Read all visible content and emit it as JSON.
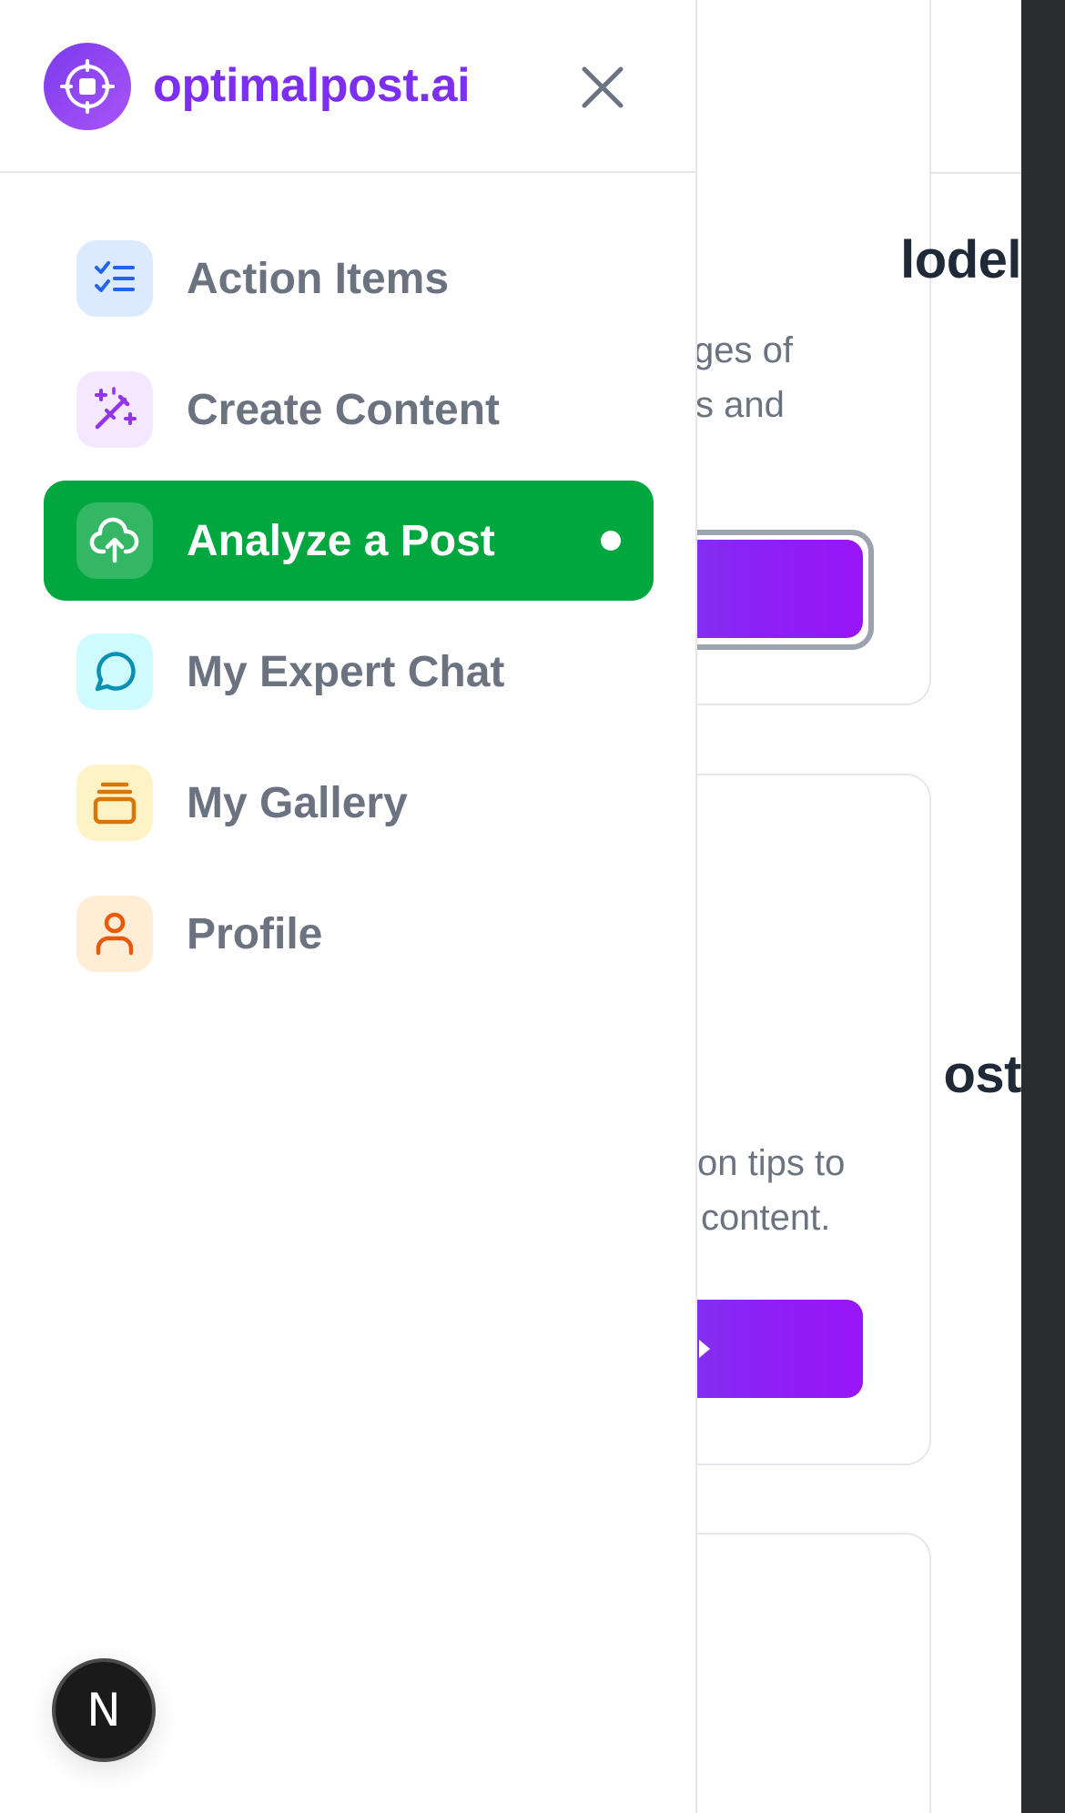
{
  "app": {
    "brand": "optimalpost.ai"
  },
  "nav": {
    "items": [
      {
        "label": "Action Items",
        "icon": "list-checks-icon",
        "icon_color": "#2563eb",
        "icon_bg": "#dbeafe",
        "active": false
      },
      {
        "label": "Create Content",
        "icon": "magic-wand-icon",
        "icon_color": "#9333ea",
        "icon_bg": "#f3e8ff",
        "active": false
      },
      {
        "label": "Analyze a Post",
        "icon": "cloud-upload-icon",
        "icon_color": "#ffffff",
        "icon_bg": "rgba(255,255,255,0.2)",
        "active": true
      },
      {
        "label": "My Expert Chat",
        "icon": "message-circle-icon",
        "icon_color": "#0891b2",
        "icon_bg": "#cffafe",
        "active": false
      },
      {
        "label": "My Gallery",
        "icon": "gallery-stack-icon",
        "icon_color": "#d97706",
        "icon_bg": "#fef3c7",
        "active": false
      },
      {
        "label": "Profile",
        "icon": "user-icon",
        "icon_color": "#ea580c",
        "icon_bg": "#ffedd5",
        "active": false
      }
    ],
    "active_color": "#00a63e"
  },
  "background": {
    "card1": {
      "title": "lodel",
      "desc_line1": "ges of",
      "desc_line2": "s and"
    },
    "card2": {
      "title": "ost",
      "desc_line1": "on tips to",
      "desc_line2": "content."
    }
  },
  "avatar": {
    "letter": "N"
  },
  "colors": {
    "brand": "#7c2ff0",
    "accent_purple": "#8b22f5",
    "text_muted": "#6b7280"
  }
}
